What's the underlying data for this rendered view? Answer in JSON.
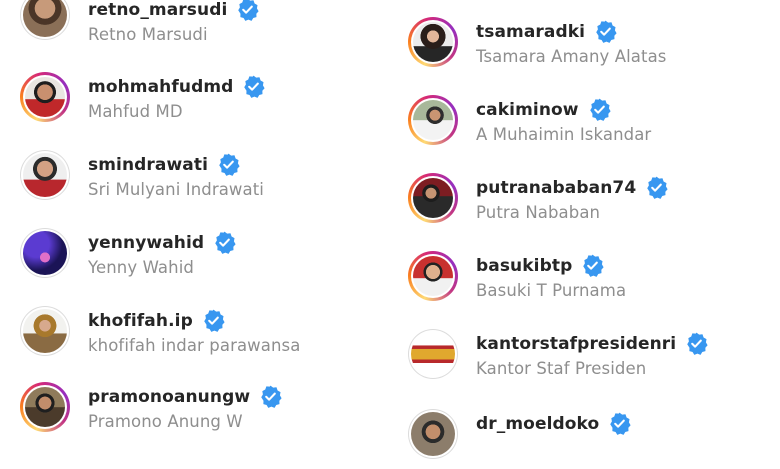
{
  "verified_icon_color": "#3897f0",
  "accounts_left": [
    {
      "username": "retno_marsudi",
      "full_name": "Retno Marsudi",
      "verified": true
    },
    {
      "username": "mohmahfudmd",
      "full_name": "Mahfud MD",
      "verified": true
    },
    {
      "username": "smindrawati",
      "full_name": "Sri Mulyani Indrawati",
      "verified": true
    },
    {
      "username": "yennywahid",
      "full_name": "Yenny Wahid",
      "verified": true
    },
    {
      "username": "khofifah.ip",
      "full_name": "khofifah indar parawansa",
      "verified": true
    },
    {
      "username": "pramonoanungw",
      "full_name": "Pramono Anung W",
      "verified": true
    }
  ],
  "accounts_right": [
    {
      "username": "tsamaradki",
      "full_name": "Tsamara Amany Alatas",
      "verified": true
    },
    {
      "username": "cakiminow",
      "full_name": "A Muhaimin Iskandar",
      "verified": true
    },
    {
      "username": "putranababan74",
      "full_name": "Putra Nababan",
      "verified": true
    },
    {
      "username": "basukibtp",
      "full_name": "Basuki T Purnama",
      "verified": true
    },
    {
      "username": "kantorstafpresidenri",
      "full_name": "Kantor Staf Presiden",
      "verified": true
    },
    {
      "username": "dr_moeldoko",
      "full_name": "",
      "verified": true
    }
  ]
}
